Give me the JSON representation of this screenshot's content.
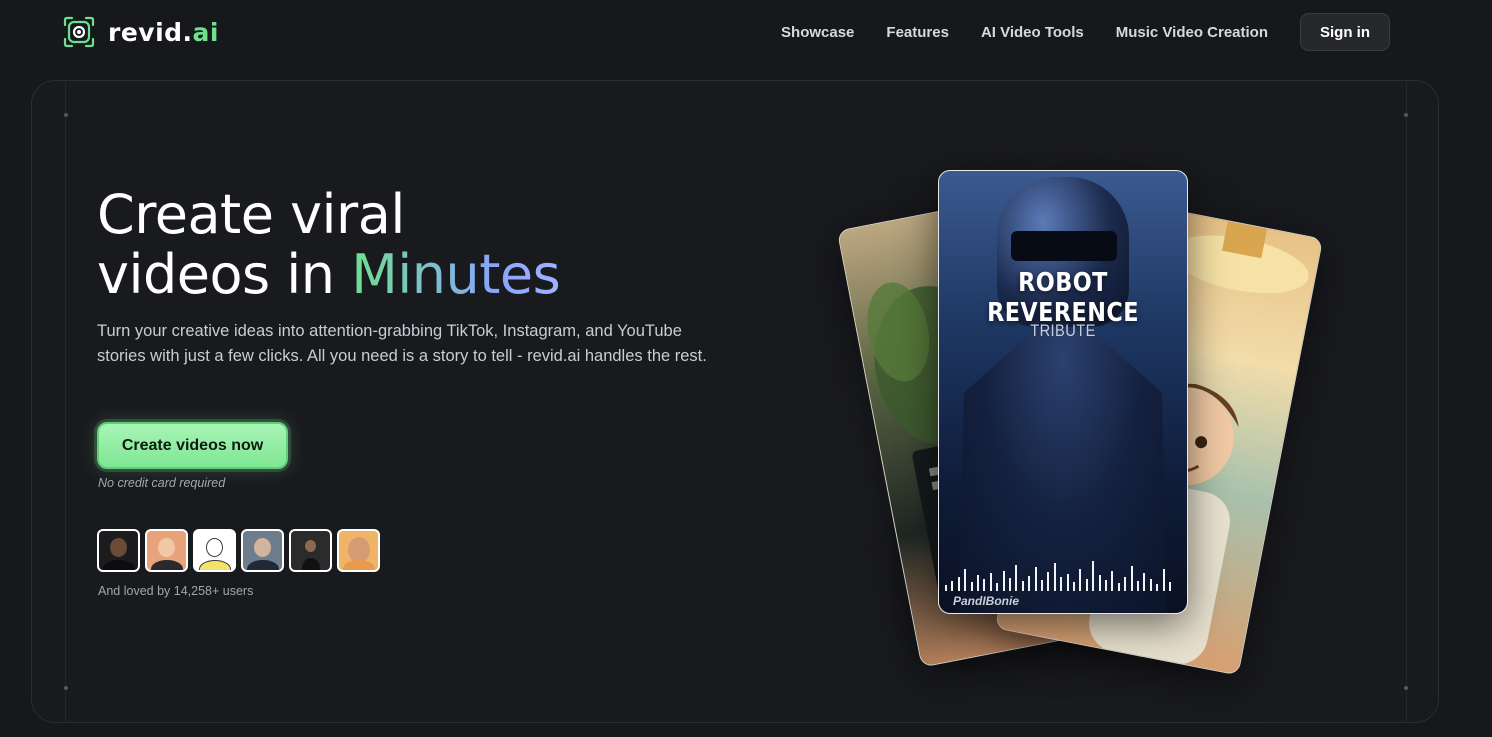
{
  "brand": {
    "name_prefix": "revid.",
    "name_suffix": "ai"
  },
  "nav": {
    "links": [
      "Showcase",
      "Features",
      "AI Video Tools",
      "Music Video Creation"
    ],
    "signin_label": "Sign in"
  },
  "hero": {
    "headline_line1": "Create viral",
    "headline_line2_prefix": "videos in ",
    "headline_highlight": "Minutes",
    "subtitle": "Turn your creative ideas into attention-grabbing TikTok, Instagram, and YouTube stories with just a few clicks. All you need is a story to tell - revid.ai handles the rest.",
    "cta_label": "Create videos now",
    "cta_note": "No credit card required",
    "social_proof": "And loved by 14,258+ users"
  },
  "showcase": {
    "main_card_title": "ROBOT REVERENCE",
    "main_card_subtitle": "TRIBUTE",
    "main_card_watermark": "PandIBonie"
  },
  "colors": {
    "background": "#17181b",
    "accent_green": "#6ee08f",
    "accent_blue": "#8aa3ff",
    "cta_fill": "#8ee99f"
  }
}
